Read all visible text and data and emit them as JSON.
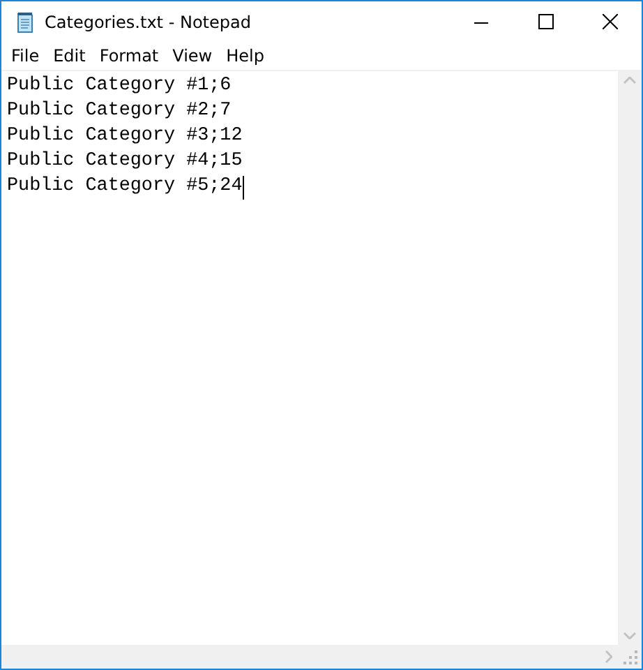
{
  "window": {
    "title": "Categories.txt - Notepad"
  },
  "menu": [
    "File",
    "Edit",
    "Format",
    "View",
    "Help"
  ],
  "lines": [
    "Public Category #1;6",
    "Public Category #2;7",
    "Public Category #3;12",
    "Public Category #4;15",
    "Public Category #5;24"
  ]
}
